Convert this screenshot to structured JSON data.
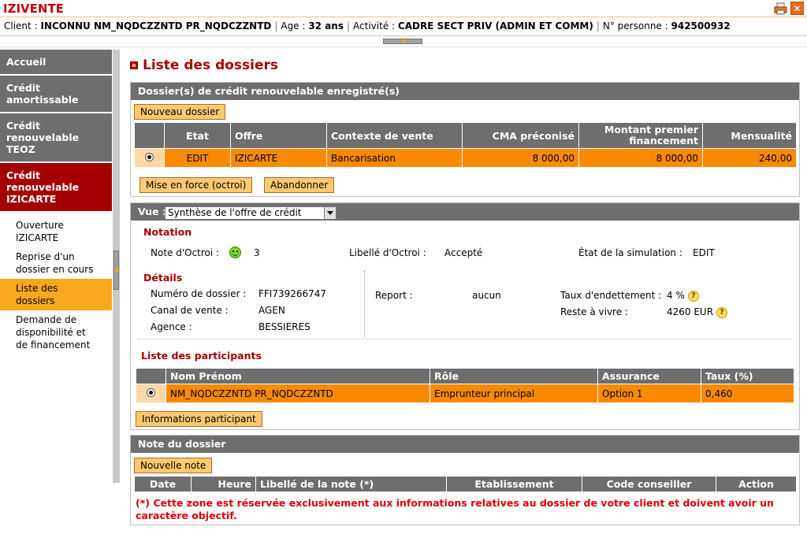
{
  "app": {
    "name": "IZIVENTE"
  },
  "client_bar": {
    "client_label": "Client :",
    "client_value": "INCONNU NM_NQDCZZNTD PR_NQDCZZNTD",
    "age_label": "Age :",
    "age_value": "32 ans",
    "activity_label": "Activité :",
    "activity_value": "CADRE SECT PRIV (ADMIN ET COMM)",
    "person_label": "N° personne :",
    "person_value": "942500932"
  },
  "sidebar": {
    "items": [
      {
        "label": "Accueil"
      },
      {
        "label": "Crédit amortissable"
      },
      {
        "label": "Crédit renouvelable TEOZ"
      },
      {
        "label": "Crédit renouvelable IZICARTE"
      }
    ],
    "sub_items": [
      {
        "label": "Ouverture IZICARTE"
      },
      {
        "label": "Reprise d'un dossier en cours"
      },
      {
        "label": "Liste des dossiers"
      },
      {
        "label": "Demande de disponibilité et de financement"
      }
    ]
  },
  "page": {
    "title": "Liste des dossiers"
  },
  "dossiers_panel": {
    "title": "Dossier(s) de crédit renouvelable enregistré(s)",
    "new_button": "Nouveau dossier",
    "columns": [
      "Etat",
      "Offre",
      "Contexte de vente",
      "CMA préconisé",
      "Montant premier financement",
      "Mensualité"
    ],
    "rows": [
      {
        "etat": "EDIT",
        "offre": "IZICARTE",
        "contexte": "Bancarisation",
        "cma": "8 000,00",
        "montant": "8 000,00",
        "mensualite": "240,00"
      }
    ],
    "enforce_button": "Mise en force (octroi)",
    "abandon_button": "Abandonner"
  },
  "vue_panel": {
    "vue_label": "Vue :",
    "vue_selected": "Synthèse de l'offre de crédit",
    "notation": {
      "title": "Notation",
      "note_octroi_label": "Note d'Octroi :",
      "note_octroi_value": "3",
      "libelle_label": "Libellé d'Octroi :",
      "libelle_value": "Accepté",
      "etat_sim_label": "État de la simulation :",
      "etat_sim_value": "EDIT"
    },
    "details": {
      "title": "Détails",
      "numero_label": "Numéro de dossier :",
      "numero_value": "FFI739266747",
      "canal_label": "Canal de vente :",
      "canal_value": "AGEN",
      "agence_label": "Agence :",
      "agence_value": "BESSIERES",
      "report_label": "Report :",
      "report_value": "aucun",
      "taux_endet_label": "Taux d'endettement :",
      "taux_endet_value": "4 %",
      "reste_label": "Reste à vivre :",
      "reste_value": "4260 EUR"
    },
    "participants": {
      "title": "Liste des participants",
      "columns": [
        "Nom Prénom",
        "Rôle",
        "Assurance",
        "Taux (%)"
      ],
      "rows": [
        {
          "nom": "NM_NQDCZZNTD PR_NQDCZZNTD",
          "role": "Emprunteur principal",
          "assurance": "Option 1",
          "taux": "0,460"
        }
      ],
      "info_button": "Informations participant"
    }
  },
  "note_panel": {
    "title": "Note du dossier",
    "new_button": "Nouvelle note",
    "columns": [
      "Date",
      "Heure",
      "Libellé de la note (*)",
      "Etablissement",
      "Code conseiller",
      "Action"
    ],
    "warning": "(*) Cette zone est réservée exclusivement aux informations relatives au dossier de votre client et doivent avoir un caractère objectif."
  },
  "colors": {
    "accent_red": "#a50000",
    "row_orange": "#f98a00",
    "header_gray": "#6e6e6e",
    "button_yellow": "#fdc970"
  }
}
